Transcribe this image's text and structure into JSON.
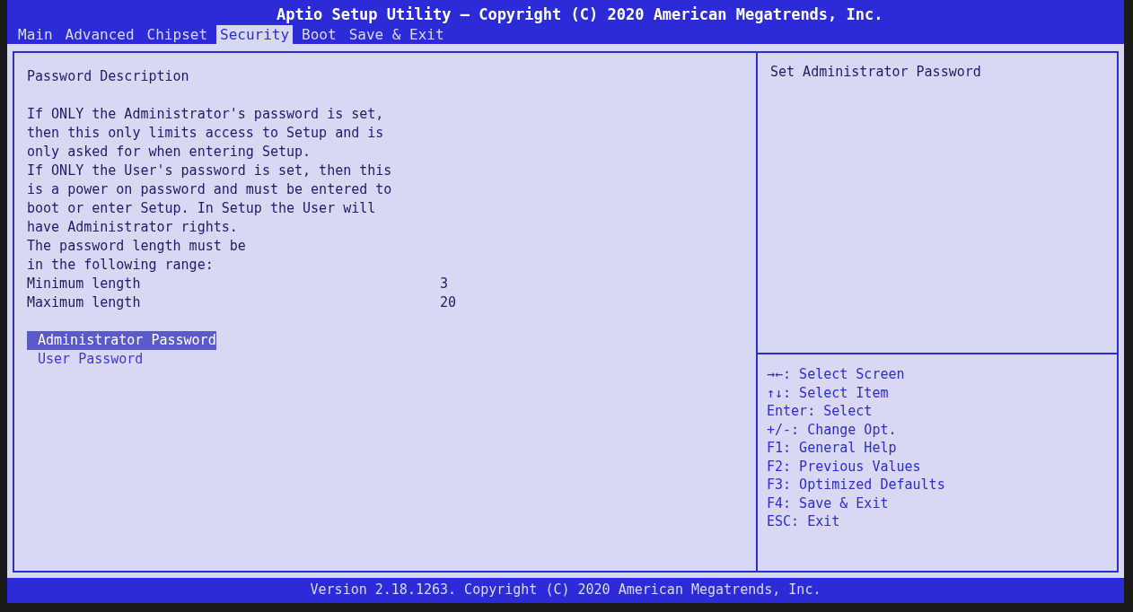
{
  "title": "Aptio Setup Utility – Copyright (C) 2020 American Megatrends, Inc.",
  "tabs": [
    {
      "label": "Main",
      "selected": false
    },
    {
      "label": "Advanced",
      "selected": false
    },
    {
      "label": "Chipset",
      "selected": false
    },
    {
      "label": "Security",
      "selected": true
    },
    {
      "label": "Boot",
      "selected": false
    },
    {
      "label": "Save & Exit",
      "selected": false
    }
  ],
  "section_title": "Password Description",
  "description_lines": [
    "If ONLY the Administrator's password is set,",
    "then this only limits access to Setup and is",
    "only asked for when entering Setup.",
    "If ONLY the User's password is set, then this",
    "is a power on password and must be entered to",
    "boot or enter Setup. In Setup the User will",
    "have Administrator rights.",
    "The password length must be",
    "in the following range:"
  ],
  "settings": [
    {
      "label": "Minimum length",
      "value": "3"
    },
    {
      "label": "Maximum length",
      "value": "20"
    }
  ],
  "menu_items": [
    {
      "label": "Administrator Password",
      "selected": true
    },
    {
      "label": "User Password",
      "selected": false
    }
  ],
  "help_text": "Set Administrator Password",
  "key_help": [
    "→←: Select Screen",
    "↑↓: Select Item",
    "Enter: Select",
    "+/-: Change Opt.",
    "F1: General Help",
    "F2: Previous Values",
    "F3: Optimized Defaults",
    "F4: Save & Exit",
    "ESC: Exit"
  ],
  "footer": "Version 2.18.1263. Copyright (C) 2020 American Megatrends, Inc."
}
